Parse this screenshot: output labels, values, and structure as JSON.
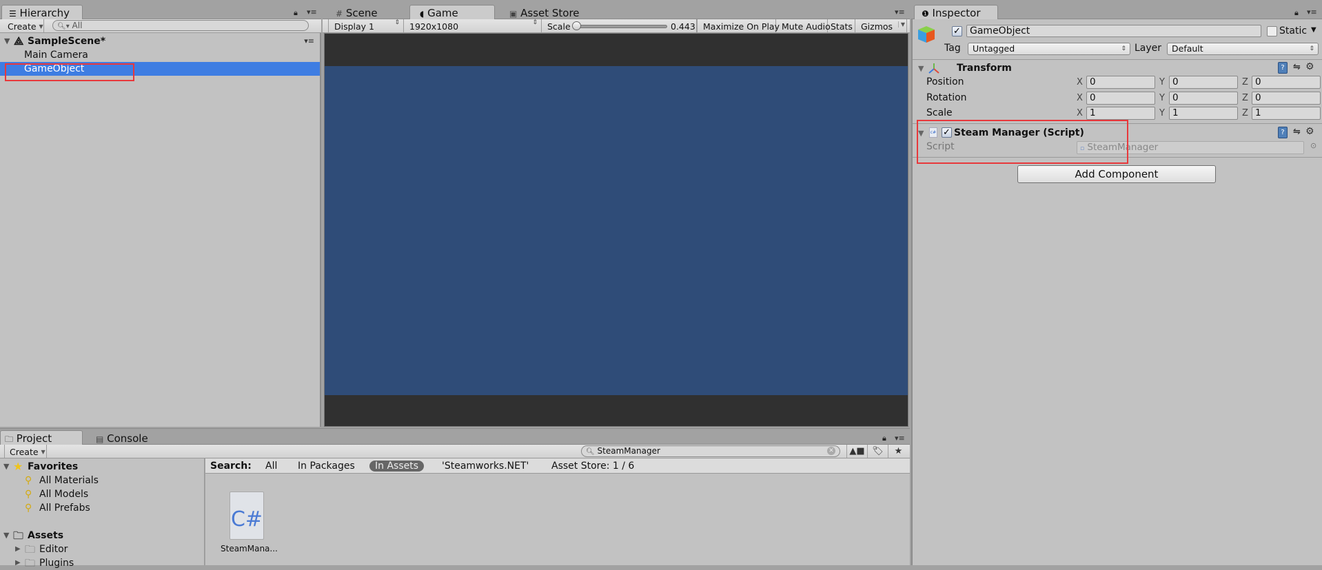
{
  "hierarchy": {
    "tab_label": "Hierarchy",
    "create_label": "Create",
    "search_placeholder": "All",
    "scene_name": "SampleScene*",
    "items": [
      {
        "label": "Main Camera",
        "selected": false
      },
      {
        "label": "GameObject",
        "selected": true
      }
    ]
  },
  "center": {
    "tabs": [
      {
        "label": "Scene",
        "icon": "grid-icon",
        "active": false
      },
      {
        "label": "Game",
        "icon": "pacman-icon",
        "active": true
      },
      {
        "label": "Asset Store",
        "icon": "bag-icon",
        "active": false
      }
    ],
    "toolbar": {
      "display": "Display 1",
      "resolution": "1920x1080",
      "scale_label": "Scale",
      "scale_value": "0.443",
      "maximize_on_play": "Maximize On Play",
      "mute_audio": "Mute Audio",
      "stats": "Stats",
      "gizmos": "Gizmos"
    },
    "game_view": {
      "background_color": "#2f4c78",
      "letterbox_color": "#303030"
    }
  },
  "inspector": {
    "tab_label": "Inspector",
    "object_name": "GameObject",
    "active": true,
    "static_label": "Static",
    "static": false,
    "tag_label": "Tag",
    "tag_value": "Untagged",
    "layer_label": "Layer",
    "layer_value": "Default",
    "transform": {
      "title": "Transform",
      "rows": [
        {
          "label": "Position",
          "x": "0",
          "y": "0",
          "z": "0"
        },
        {
          "label": "Rotation",
          "x": "0",
          "y": "0",
          "z": "0"
        },
        {
          "label": "Scale",
          "x": "1",
          "y": "1",
          "z": "1"
        }
      ],
      "axis_x": "X",
      "axis_y": "Y",
      "axis_z": "Z"
    },
    "script_component": {
      "title": "Steam Manager (Script)",
      "enabled": true,
      "script_label": "Script",
      "script_value": "SteamManager"
    },
    "add_component_label": "Add Component"
  },
  "project": {
    "tabs": [
      {
        "label": "Project",
        "active": true
      },
      {
        "label": "Console",
        "active": false
      }
    ],
    "create_label": "Create",
    "search_value": "SteamManager",
    "favorites": {
      "label": "Favorites",
      "items": [
        "All Materials",
        "All Models",
        "All Prefabs"
      ]
    },
    "assets": {
      "label": "Assets",
      "items": [
        "Editor",
        "Plugins"
      ]
    },
    "search_bar": {
      "label": "Search:",
      "options": [
        "All",
        "In Packages",
        "In Assets",
        "'Steamworks.NET'"
      ],
      "selected": "In Assets",
      "asset_store": "Asset Store: 1 / 6"
    },
    "results": [
      {
        "name": "SteamMana...",
        "icon_text": "C#"
      }
    ]
  },
  "colors": {
    "selection": "#3e7de2",
    "highlight_box": "#e8383b"
  }
}
